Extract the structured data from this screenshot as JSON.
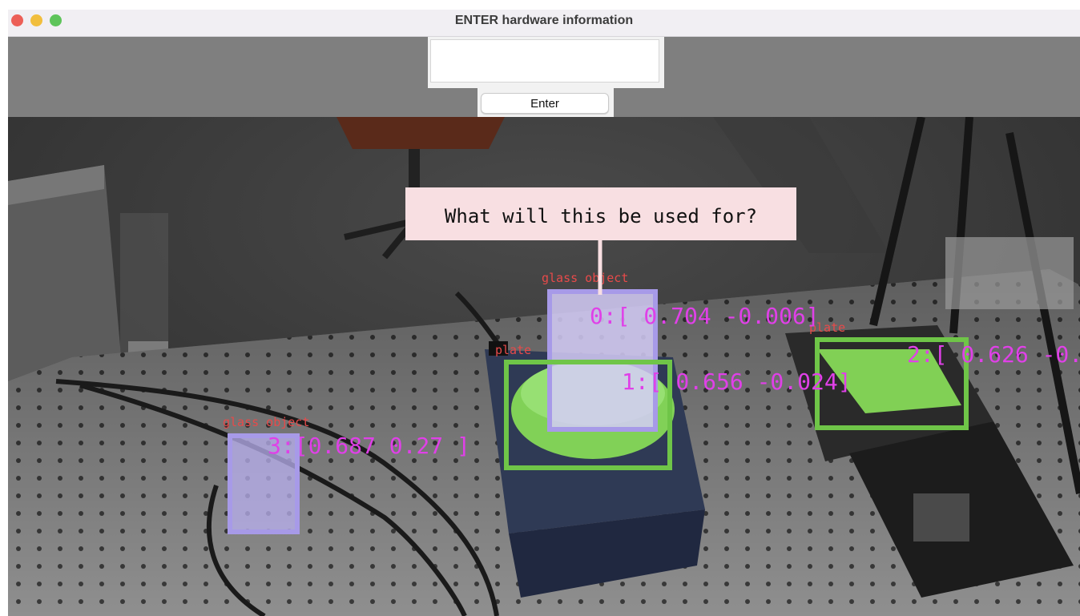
{
  "window": {
    "title": "ENTER hardware information"
  },
  "form": {
    "input_value": "",
    "input_placeholder": "",
    "enter_label": "Enter"
  },
  "overlay": {
    "prompt": "What will this be used for?",
    "detections": [
      {
        "id": 0,
        "label": "glass object",
        "coords": "0:[ 0.704 -0.006]"
      },
      {
        "id": 1,
        "label": "plate",
        "coords": "1:[ 0.656 -0.024]"
      },
      {
        "id": 2,
        "label": "plate",
        "coords": "2:[ 0.626 -0."
      },
      {
        "id": 3,
        "label": "glass object",
        "coords": "3:[0.687 0.27 ]"
      }
    ]
  },
  "colors": {
    "glass_box": "#a79ae8",
    "plate_box": "#8fe06a",
    "coords_text": "#e040e8",
    "label_text": "#e84a4a",
    "prompt_bg": "#f8dfe2"
  },
  "icons": {
    "close": "traffic-close-icon",
    "minimize": "traffic-minimize-icon",
    "maximize": "traffic-maximize-icon"
  }
}
